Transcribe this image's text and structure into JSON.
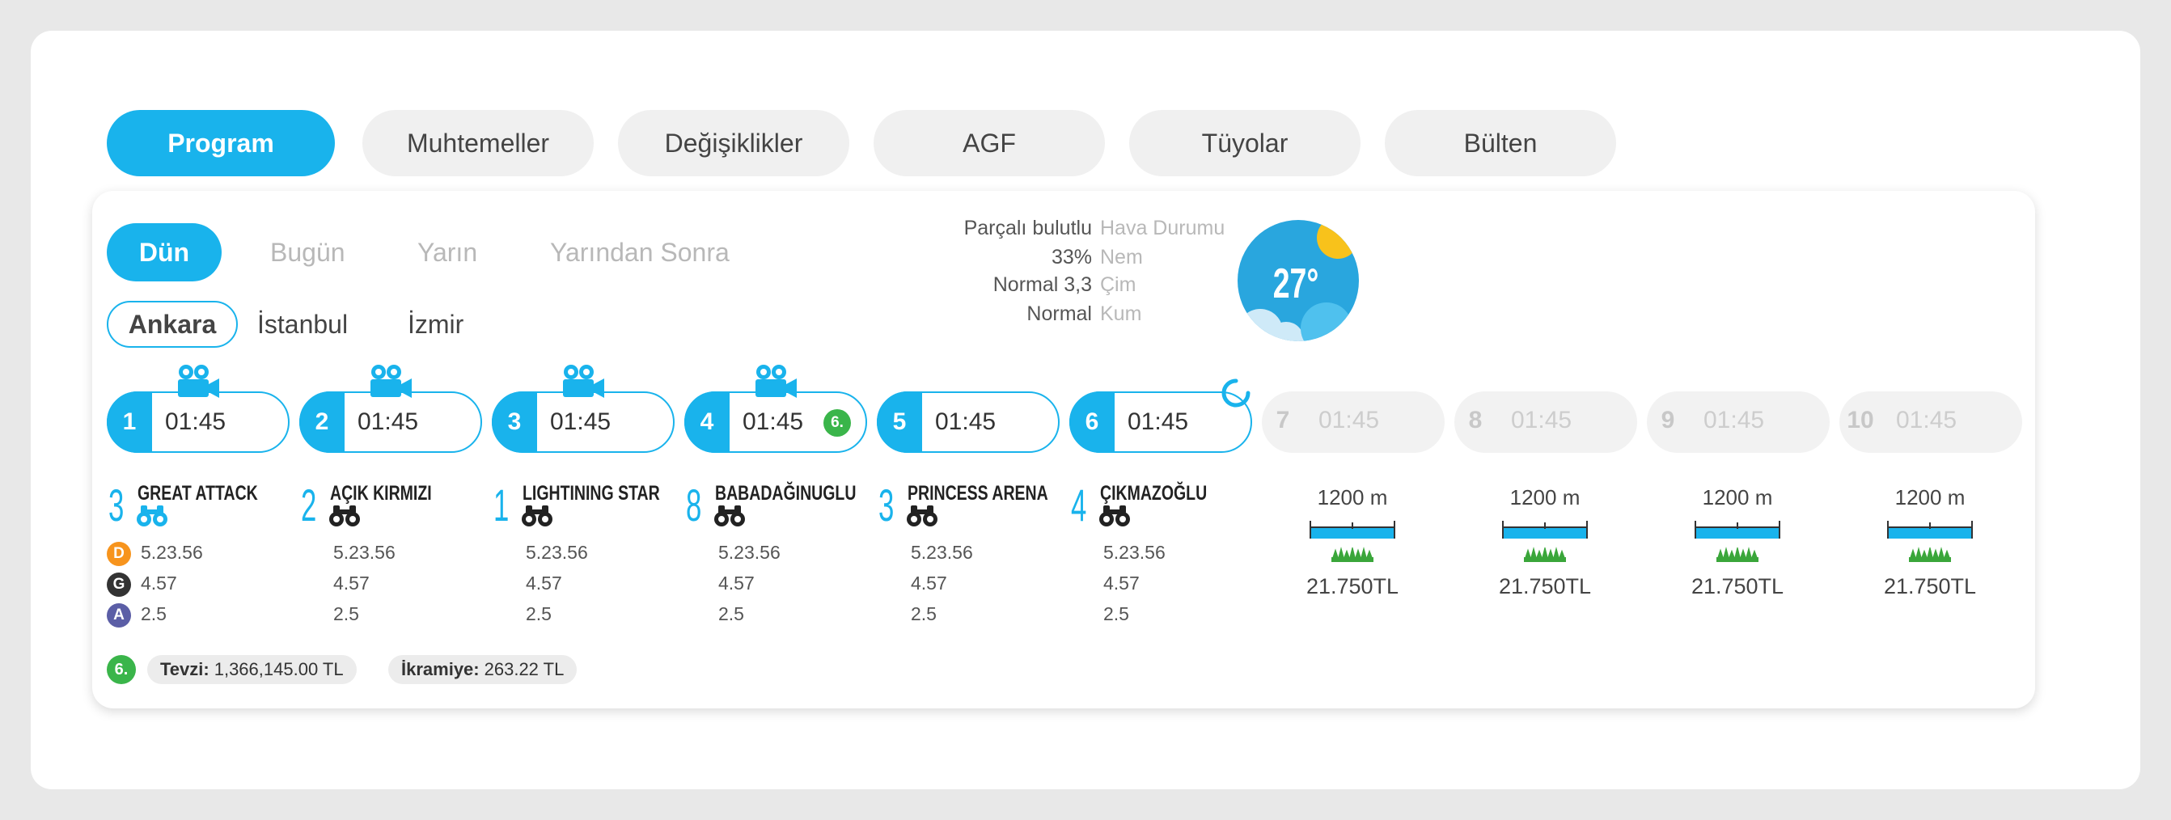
{
  "main_tabs": [
    "Program",
    "Muhtemeller",
    "Değişiklikler",
    "AGF",
    "Tüyolar",
    "Bülten"
  ],
  "day_tabs": [
    "Dün",
    "Bugün",
    "Yarın",
    "Yarından Sonra"
  ],
  "cities": [
    "Ankara",
    "İstanbul",
    "İzmir"
  ],
  "weather": {
    "rows": [
      {
        "value": "Parçalı bulutlu",
        "label": "Hava Durumu"
      },
      {
        "value": "33%",
        "label": "Nem"
      },
      {
        "value": "Normal 3,3",
        "label": "Çim"
      },
      {
        "value": "Normal",
        "label": "Kum"
      }
    ],
    "temperature": "27°",
    "icon": "partly-cloudy-sun-icon"
  },
  "races": [
    {
      "num": "1",
      "time": "01:45",
      "camera": true
    },
    {
      "num": "2",
      "time": "01:45",
      "camera": true
    },
    {
      "num": "3",
      "time": "01:45",
      "camera": true
    },
    {
      "num": "4",
      "time": "01:45",
      "camera": true,
      "badge": "6."
    },
    {
      "num": "5",
      "time": "01:45",
      "camera": false
    },
    {
      "num": "6",
      "time": "01:45",
      "camera": false,
      "refresh": true
    },
    {
      "num": "7",
      "time": "01:45",
      "camera": false
    },
    {
      "num": "8",
      "time": "01:45",
      "camera": false
    },
    {
      "num": "9",
      "time": "01:45",
      "camera": false
    },
    {
      "num": "10",
      "time": "01:45",
      "camera": false
    }
  ],
  "legend": [
    {
      "letter": "D",
      "color": "#f7941d"
    },
    {
      "letter": "G",
      "color": "#333333"
    },
    {
      "letter": "A",
      "color": "#5b5ea6"
    }
  ],
  "winners": [
    {
      "pos": "3",
      "name": "GREAT ATTACK",
      "d": "5.23.56",
      "g": "4.57",
      "a": "2.5",
      "bino_color": "#19b3ec"
    },
    {
      "pos": "2",
      "name": "AÇIK KIRMIZI",
      "d": "5.23.56",
      "g": "4.57",
      "a": "2.5",
      "bino_color": "#222222"
    },
    {
      "pos": "1",
      "name": "LIGHTINING STAR",
      "d": "5.23.56",
      "g": "4.57",
      "a": "2.5",
      "bino_color": "#222222"
    },
    {
      "pos": "8",
      "name": "BABADAĞINUGLU",
      "d": "5.23.56",
      "g": "4.57",
      "a": "2.5",
      "bino_color": "#222222"
    },
    {
      "pos": "3",
      "name": "PRINCESS ARENA",
      "d": "5.23.56",
      "g": "4.57",
      "a": "2.5",
      "bino_color": "#222222"
    },
    {
      "pos": "4",
      "name": "ÇIKMAZOĞLU",
      "d": "5.23.56",
      "g": "4.57",
      "a": "2.5",
      "bino_color": "#222222"
    }
  ],
  "upcoming": [
    {
      "distance": "1200 m",
      "prize": "21.750TL"
    },
    {
      "distance": "1200 m",
      "prize": "21.750TL"
    },
    {
      "distance": "1200 m",
      "prize": "21.750TL"
    },
    {
      "distance": "1200 m",
      "prize": "21.750TL"
    }
  ],
  "footer": {
    "badge": "6.",
    "tevzi_label": "Tevzi:",
    "tevzi_value": "1,366,145.00 TL",
    "ikramiye_label": "İkramiye:",
    "ikramiye_value": "263.22 TL"
  },
  "colors": {
    "accent": "#19b3ec",
    "green": "#3ab54a"
  }
}
